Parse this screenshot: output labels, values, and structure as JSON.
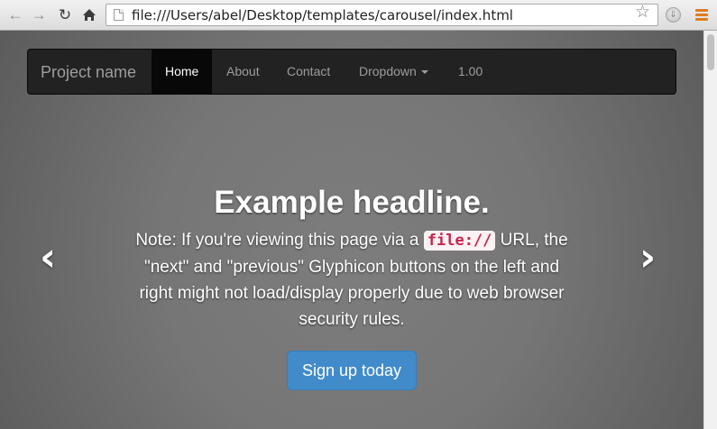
{
  "browser": {
    "url": "file:///Users/abel/Desktop/templates/carousel/index.html",
    "icons": [
      "back-arrow-icon",
      "forward-arrow-icon",
      "reload-icon",
      "home-icon",
      "page-icon",
      "star-icon",
      "extension-icon",
      "menu-icon"
    ]
  },
  "navbar": {
    "brand": "Project name",
    "items": [
      {
        "label": "Home",
        "active": true
      },
      {
        "label": "About"
      },
      {
        "label": "Contact"
      },
      {
        "label": "Dropdown"
      },
      {
        "label": "1.00"
      }
    ]
  },
  "carousel": {
    "headline": "Example headline.",
    "note_before": "Note: If you're viewing this page via a ",
    "note_code": "file://",
    "note_after": " URL, the \"next\" and \"previous\" Glyphicon buttons on the left and right might not load/display properly due to web browser security rules.",
    "button": "Sign up today",
    "prev_arrow": "‹",
    "next_arrow": "›"
  },
  "colors": {
    "navbar_bg": "#222222",
    "button_bg": "#428bca",
    "code_color": "#c7254e",
    "menu_accent": "#e07b1f"
  }
}
